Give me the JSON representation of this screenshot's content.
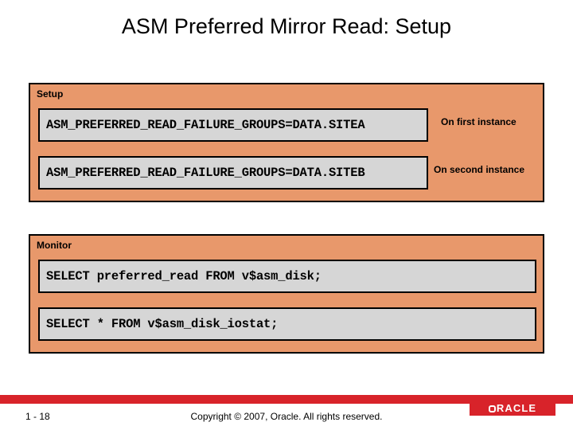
{
  "title": "ASM Preferred Mirror Read: Setup",
  "setup": {
    "label": "Setup",
    "items": [
      {
        "code": "ASM_PREFERRED_READ_FAILURE_GROUPS=DATA.SITEA",
        "annotation": "On first instance"
      },
      {
        "code": "ASM_PREFERRED_READ_FAILURE_GROUPS=DATA.SITEB",
        "annotation": "On second instance"
      }
    ]
  },
  "monitor": {
    "label": "Monitor",
    "items": [
      {
        "code": "SELECT preferred_read FROM v$asm_disk;"
      },
      {
        "code": "SELECT * FROM v$asm_disk_iostat;"
      }
    ]
  },
  "footer": {
    "page": "1 - 18",
    "copyright": "Copyright © 2007, Oracle. All rights reserved.",
    "logo": "ORACLE"
  }
}
